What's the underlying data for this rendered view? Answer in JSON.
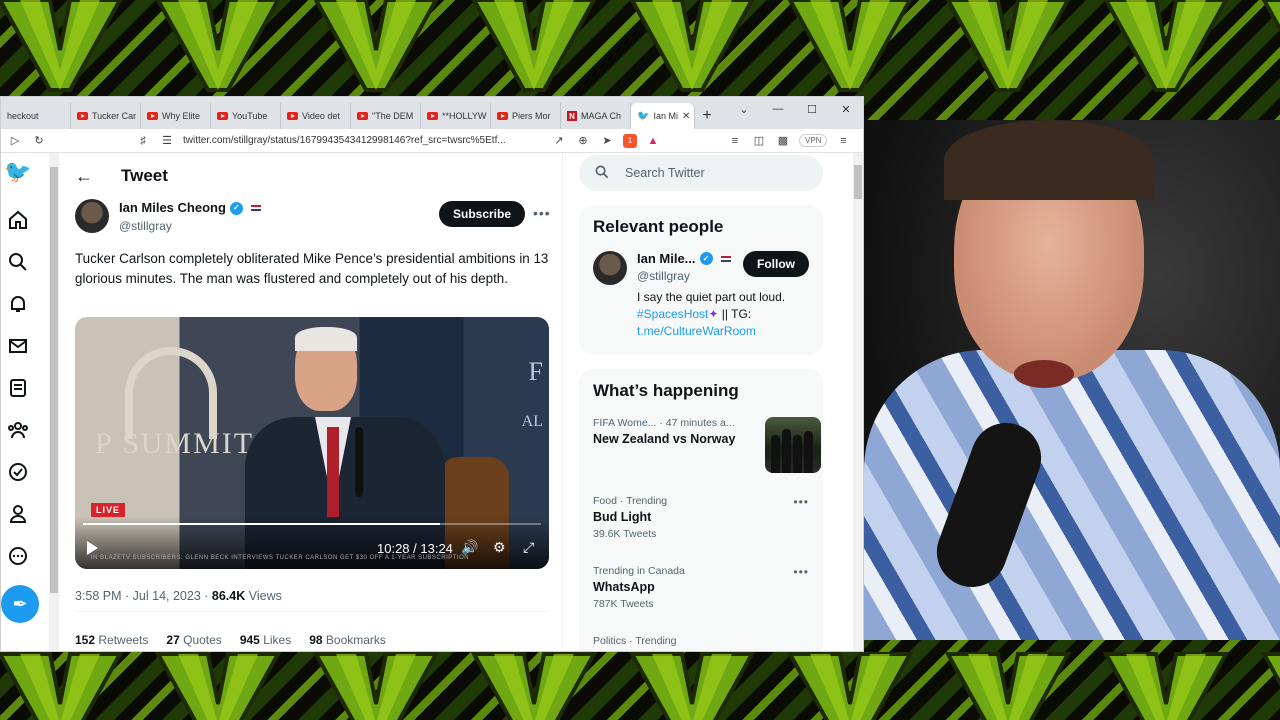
{
  "browser": {
    "tabs": [
      {
        "label": "heckout",
        "icon": "blank"
      },
      {
        "label": "Tucker Car",
        "icon": "youtube-icon"
      },
      {
        "label": "Why Elite",
        "icon": "youtube-icon"
      },
      {
        "label": "YouTube",
        "icon": "youtube-icon"
      },
      {
        "label": "Video det",
        "icon": "youtube-icon"
      },
      {
        "label": "\"The DEM",
        "icon": "youtube-icon"
      },
      {
        "label": "**HOLLYW",
        "icon": "youtube-icon"
      },
      {
        "label": "Piers Mor",
        "icon": "youtube-icon"
      },
      {
        "label": "MAGA Ch",
        "icon": "netflix-icon"
      }
    ],
    "active_tab": "Ian Mi",
    "new_tab": "+",
    "url": "twitter.com/stillgray/status/1679943543412998146?ref_src=twsrc%5Etf...",
    "vpn_label": "VPN",
    "shield_badge": "1",
    "rewards_badge": "1"
  },
  "tweet": {
    "header_title": "Tweet",
    "author_name": "Ian Miles Cheong",
    "author_handle": "@stillgray",
    "subscribe_label": "Subscribe",
    "text": "Tucker Carlson completely obliterated Mike Pence’s presidential ambitions in 13 glorious minutes. The man was flustered and completely out of his depth.",
    "video": {
      "live_badge": "LIVE",
      "time": "10:28 / 13:24",
      "progress": 0.78,
      "ticker": "IN BLAZETV SUBSCRIBERS: GLENN BECK INTERVIEWS TUCKER CARLSON    GET $30 OFF A 1-YEAR SUBSCRIPTION",
      "bg_text_left": "P SUMMIT",
      "bg_text_right_1": "F",
      "bg_text_right_2": "AL"
    },
    "time": "3:58 PM",
    "date": "Jul 14, 2023",
    "views_count": "86.4K",
    "views_label": "Views",
    "stats": [
      {
        "count": "152",
        "label": "Retweets"
      },
      {
        "count": "27",
        "label": "Quotes"
      },
      {
        "count": "945",
        "label": "Likes"
      },
      {
        "count": "98",
        "label": "Bookmarks"
      }
    ]
  },
  "sidebar": {
    "search_placeholder": "Search Twitter",
    "relevant_title": "Relevant people",
    "relevant_person": {
      "name": "Ian Mile...",
      "handle": "@stillgray",
      "follow_label": "Follow",
      "bio_line1": "I say the quiet part out loud.",
      "bio_hashtag": "#SpacesHost",
      "bio_sep": "|| TG:",
      "bio_link": "t.me/CultureWarRoom"
    },
    "happening_title": "What’s happening",
    "trends": [
      {
        "context": "FIFA Wome... · 47 minutes a...",
        "title": "New Zealand vs Norway",
        "count": ""
      },
      {
        "context": "Food · Trending",
        "title": "Bud Light",
        "count": "39.6K Tweets"
      },
      {
        "context": "Trending in Canada",
        "title": "WhatsApp",
        "count": "787K Tweets"
      },
      {
        "context": "Politics · Trending",
        "title": "",
        "count": ""
      }
    ]
  },
  "colors": {
    "twitter_blue": "#1d9bf0",
    "text_primary": "#0f1419",
    "text_secondary": "#536471",
    "brand_green": "#5b8a0c"
  }
}
